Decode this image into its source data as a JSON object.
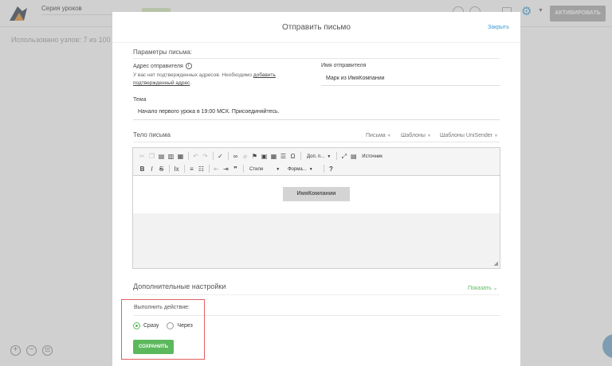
{
  "app": {
    "series_title": "Серия уроков",
    "activate_label": "АКТИВИРОВАТЬ",
    "nodes_used": "Использовано узлов: 7 из 100",
    "zoom_in": "+",
    "zoom_out": "−",
    "fit": "⊡"
  },
  "modal": {
    "title": "Отправить письмо",
    "close_label": "Закрыть",
    "params_title": "Параметры письма:",
    "sender_address_label": "Адрес отправителя",
    "sender_note_text": "У вас нет подтвержденных адресов. Необходимо ",
    "sender_note_link": "добавить подтвержденный адрес",
    "sender_note_end": ".",
    "sender_name_label": "Имя отправителя",
    "sender_name_value": "Марк из ИмяКомпании",
    "subject_label": "Тема",
    "subject_value": "Начало первого урока в 19:00 МСК. Присоединяйтесь.",
    "body_title": "Тело письма",
    "tabs": [
      "Письма",
      "Шаблоны",
      "Шаблоны UniSender"
    ],
    "editor": {
      "styles_label": "Стили",
      "format_label": "Форма...",
      "dop_label": "Доп. п...",
      "source_label": "Источник",
      "company_button": "ИмяКомпании"
    },
    "advanced_title": "Дополнительные настройки",
    "show_label": "Показать",
    "action_label": "Выполнить действие:",
    "radio_now": "Сразу",
    "radio_after": "Через",
    "save_label": "СОХРАНИТЬ"
  },
  "colors": {
    "accent_green": "#5cb85c",
    "link_blue": "#3a9bd5",
    "highlight_red": "#e06060"
  }
}
